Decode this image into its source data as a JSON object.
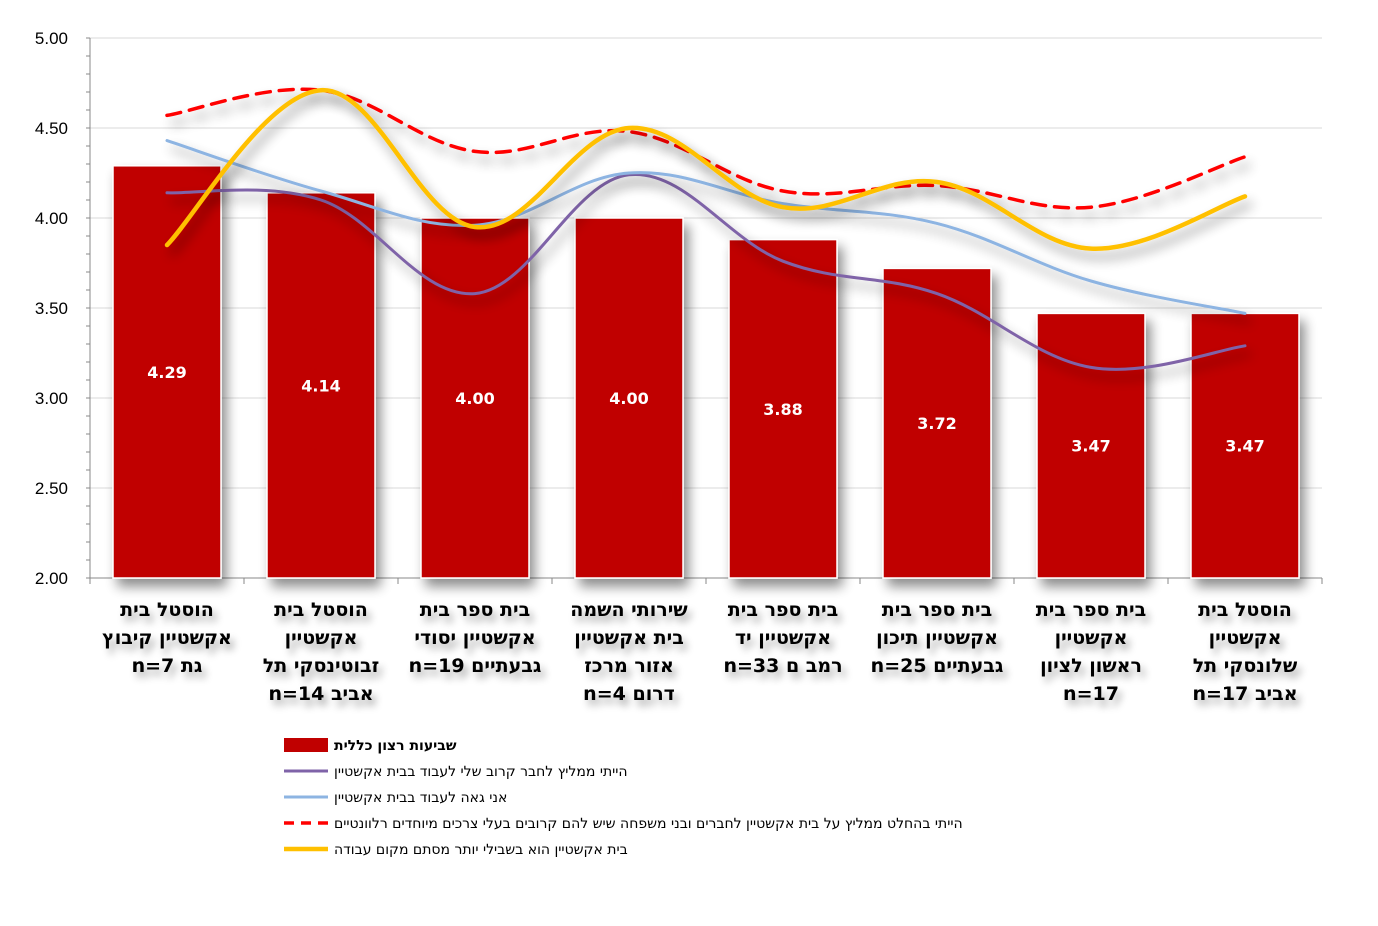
{
  "chart_data": {
    "type": "bar",
    "categories": [
      [
        "הוסטל בית",
        "אקשטיין  קיבוץ",
        "גת   n=7"
      ],
      [
        "הוסטל בית",
        "אקשטיין",
        "זבוטינסקי תל",
        "אביב   n=14"
      ],
      [
        "בית ספר בית",
        "אקשטיין יסודי",
        "גבעתיים   n=19"
      ],
      [
        "שירותי השמה",
        "בית אקשטיין",
        "אזור מרכז",
        "דרום   n=4"
      ],
      [
        "בית ספר בית",
        "אקשטיין   יד",
        "רמב ם   n=33"
      ],
      [
        "בית ספר בית",
        "אקשטיין תיכון",
        "גבעתיים   n=25"
      ],
      [
        "בית ספר בית",
        "אקשטיין",
        "ראשון לציון",
        "n=17"
      ],
      [
        "הוסטל בית",
        "אקשטיין",
        "שלונסקי תל",
        "אביב   n=17"
      ]
    ],
    "ylim": [
      2.0,
      5.0
    ],
    "yticks": [
      "2.00",
      "2.50",
      "3.00",
      "3.50",
      "4.00",
      "4.50",
      "5.00"
    ],
    "grid": true,
    "legend_position": "bottom",
    "series": [
      {
        "name": "שביעות רצון כללית",
        "kind": "bar",
        "color": "#C00000",
        "values": [
          4.29,
          4.14,
          4.0,
          4.0,
          3.88,
          3.72,
          3.47,
          3.47
        ],
        "labels": [
          "4.29",
          "4.14",
          "4.00",
          "4.00",
          "3.88",
          "3.72",
          "3.47",
          "3.47"
        ]
      },
      {
        "name": "הייתי ממליץ לחבר קרוב שלי לעבוד בבית אקשטיין",
        "kind": "line",
        "color": "#7F63A8",
        "values": [
          4.14,
          4.1,
          3.58,
          4.24,
          3.76,
          3.58,
          3.17,
          3.29
        ]
      },
      {
        "name": "אני גאה לעבוד בבית אקשטיין",
        "kind": "line",
        "color": "#8DB4E2",
        "values": [
          4.43,
          4.15,
          3.96,
          4.25,
          4.08,
          3.97,
          3.65,
          3.47
        ]
      },
      {
        "name": "הייתי בהחלט ממליץ על בית אקשטיין לחברים ובני משפחה שיש להם קרובים בעלי צרכים מיוחדים רלוונטיים",
        "kind": "line",
        "dashed": true,
        "color": "#FF0000",
        "values": [
          4.57,
          4.71,
          4.37,
          4.48,
          4.15,
          4.18,
          4.06,
          4.34
        ]
      },
      {
        "name": "בית אקשטיין הוא בשבילי יותר מסתם מקום עבודה",
        "kind": "line",
        "color": "#FFC000",
        "values": [
          3.85,
          4.71,
          3.95,
          4.5,
          4.06,
          4.2,
          3.83,
          4.12
        ]
      }
    ]
  }
}
